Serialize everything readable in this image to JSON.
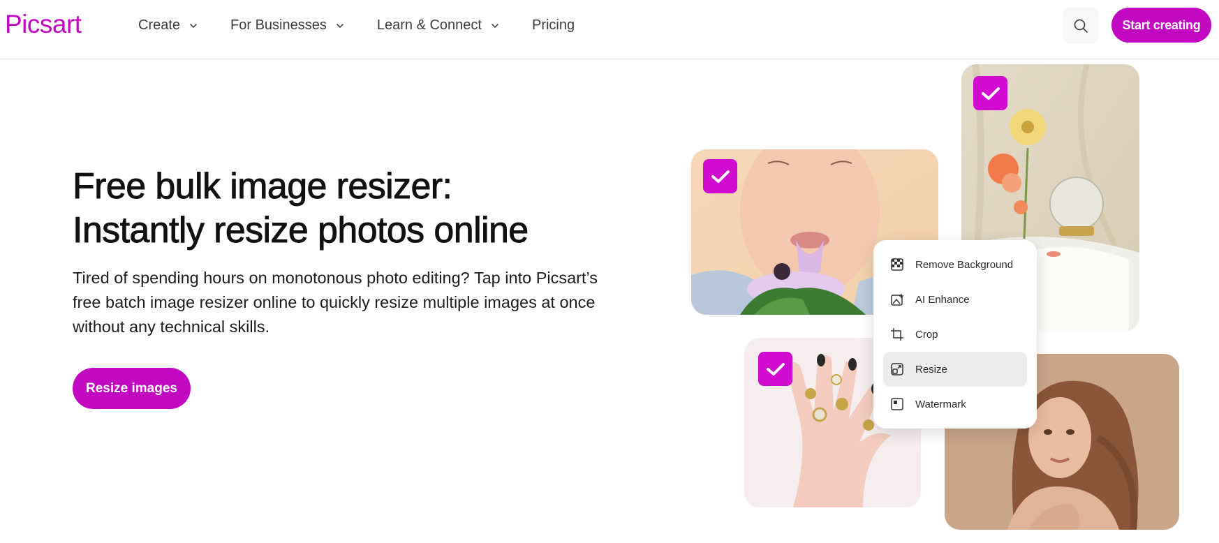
{
  "brand": {
    "logo": "Picsart",
    "accent": "#c209c1"
  },
  "nav": {
    "items": [
      {
        "label": "Create",
        "has_dropdown": true
      },
      {
        "label": "For Businesses",
        "has_dropdown": true
      },
      {
        "label": "Learn & Connect",
        "has_dropdown": true
      },
      {
        "label": "Pricing",
        "has_dropdown": false
      }
    ],
    "search_icon": "search-icon",
    "cta": "Start creating"
  },
  "hero": {
    "title_line1": "Free bulk image resizer:",
    "title_line2": "Instantly resize photos online",
    "description": "Tired of spending hours on monotonous photo editing? Tap into Picsart’s free batch image resizer online to quickly resize multiple images at once without any technical skills.",
    "cta": "Resize images"
  },
  "collage": {
    "selected_icon": "check-icon",
    "menu": [
      {
        "label": "Remove Background",
        "icon": "remove-background-icon",
        "active": false
      },
      {
        "label": "AI Enhance",
        "icon": "ai-enhance-icon",
        "active": false
      },
      {
        "label": "Crop",
        "icon": "crop-icon",
        "active": false
      },
      {
        "label": "Resize",
        "icon": "resize-icon",
        "active": true
      },
      {
        "label": "Watermark",
        "icon": "watermark-icon",
        "active": false
      }
    ]
  }
}
